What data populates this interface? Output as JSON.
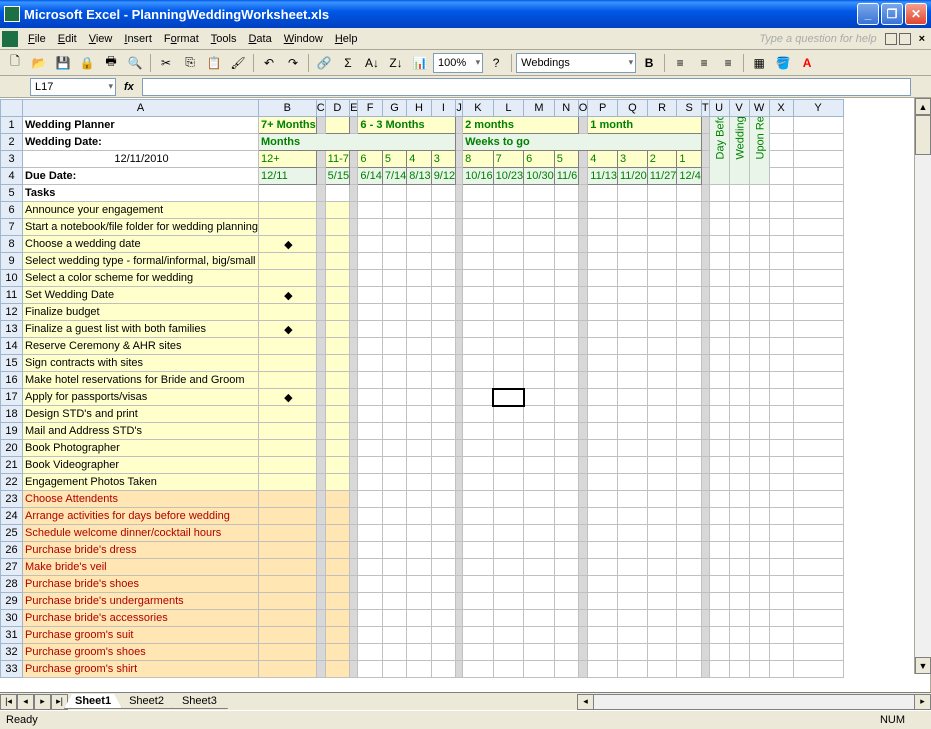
{
  "app": {
    "title": "Microsoft Excel - PlanningWeddingWorksheet.xls"
  },
  "menu": {
    "file": "File",
    "edit": "Edit",
    "view": "View",
    "insert": "Insert",
    "format": "Format",
    "tools": "Tools",
    "data": "Data",
    "window": "Window",
    "help": "Help",
    "question": "Type a question for help"
  },
  "toolbar": {
    "zoom": "100%",
    "font": "Webdings"
  },
  "formula": {
    "namebox": "L17",
    "value": ""
  },
  "sheet": {
    "title": "Wedding Planner",
    "wedding_date_label": "Wedding Date:",
    "wedding_date": "12/11/2010",
    "due_date_label": "Due Date:",
    "tasks_label": "Tasks",
    "groups": {
      "g1": "7+ Months",
      "g2": "6 - 3 Months",
      "g3": "2 months",
      "g4": "1 month",
      "sub1": "Months",
      "sub2": "Weeks to go",
      "n_b": "12+",
      "n_d": "11-7",
      "n_f": "6",
      "n_g": "5",
      "n_h": "4",
      "n_i": "3",
      "n_k": "8",
      "n_l": "7",
      "n_m": "6",
      "n_n": "5",
      "n_p": "4",
      "n_q": "3",
      "n_r": "2",
      "n_s": "1",
      "d_b": "12/11",
      "d_d": "5/15",
      "d_f": "6/14",
      "d_g": "7/14",
      "d_h": "8/13",
      "d_i": "9/12",
      "d_k": "10/16",
      "d_l": "10/23",
      "d_m": "10/30",
      "d_n": "11/6",
      "d_p": "11/13",
      "d_q": "11/20",
      "d_r": "11/27",
      "d_s": "12/4",
      "rot1": "Day Before",
      "rot2": "Wedding Day",
      "rot3": "Upon Return"
    },
    "rows": [
      {
        "n": 6,
        "t": "Announce your engagement",
        "c": "task-yellow"
      },
      {
        "n": 7,
        "t": "Start a notebook/file folder for wedding planning",
        "c": "task-yellow"
      },
      {
        "n": 8,
        "t": "Choose a wedding date",
        "c": "task-yellow",
        "d": true
      },
      {
        "n": 9,
        "t": "Select wedding type - formal/informal, big/small",
        "c": "task-yellow"
      },
      {
        "n": 10,
        "t": "Select a color scheme for wedding",
        "c": "task-yellow"
      },
      {
        "n": 11,
        "t": "Set Wedding Date",
        "c": "task-yellow",
        "d": true
      },
      {
        "n": 12,
        "t": "Finalize budget",
        "c": "task-yellow"
      },
      {
        "n": 13,
        "t": "Finalize a guest list with both families",
        "c": "task-yellow",
        "d": true
      },
      {
        "n": 14,
        "t": "Reserve Ceremony & AHR sites",
        "c": "task-yellow"
      },
      {
        "n": 15,
        "t": "Sign contracts with sites",
        "c": "task-yellow"
      },
      {
        "n": 16,
        "t": "Make hotel reservations for Bride and Groom",
        "c": "task-yellow"
      },
      {
        "n": 17,
        "t": "Apply for passports/visas",
        "c": "task-yellow",
        "d": true
      },
      {
        "n": 18,
        "t": "Design STD's and print",
        "c": "task-yellow"
      },
      {
        "n": 19,
        "t": "Mail and Address STD's",
        "c": "task-yellow"
      },
      {
        "n": 20,
        "t": "Book Photographer",
        "c": "task-yellow"
      },
      {
        "n": 21,
        "t": "Book Videographer",
        "c": "task-yellow"
      },
      {
        "n": 22,
        "t": "Engagement Photos Taken",
        "c": "task-yellow"
      },
      {
        "n": 23,
        "t": "Choose Attendents",
        "c": "task-orange task-choose"
      },
      {
        "n": 24,
        "t": "Arrange activities for days before wedding",
        "c": "task-orange task-red"
      },
      {
        "n": 25,
        "t": "Schedule welcome dinner/cocktail hours",
        "c": "task-orange task-red"
      },
      {
        "n": 26,
        "t": "Purchase bride's dress",
        "c": "task-orange task-red"
      },
      {
        "n": 27,
        "t": "Make bride's veil",
        "c": "task-orange task-red"
      },
      {
        "n": 28,
        "t": "Purchase bride's shoes",
        "c": "task-orange task-red"
      },
      {
        "n": 29,
        "t": "Purchase bride's undergarments",
        "c": "task-orange task-red"
      },
      {
        "n": 30,
        "t": "Purchase bride's accessories",
        "c": "task-orange task-red"
      },
      {
        "n": 31,
        "t": "Purchase groom's suit",
        "c": "task-orange task-red"
      },
      {
        "n": 32,
        "t": "Purchase groom's shoes",
        "c": "task-orange task-red"
      },
      {
        "n": 33,
        "t": "Purchase groom's shirt",
        "c": "task-orange task-red"
      }
    ],
    "cols": [
      "A",
      "B",
      "C",
      "D",
      "E",
      "F",
      "G",
      "H",
      "I",
      "J",
      "K",
      "L",
      "M",
      "N",
      "O",
      "P",
      "Q",
      "R",
      "S",
      "T",
      "U",
      "V",
      "W",
      "X",
      "Y"
    ]
  },
  "tabs": {
    "s1": "Sheet1",
    "s2": "Sheet2",
    "s3": "Sheet3"
  },
  "status": {
    "ready": "Ready",
    "num": "NUM"
  }
}
